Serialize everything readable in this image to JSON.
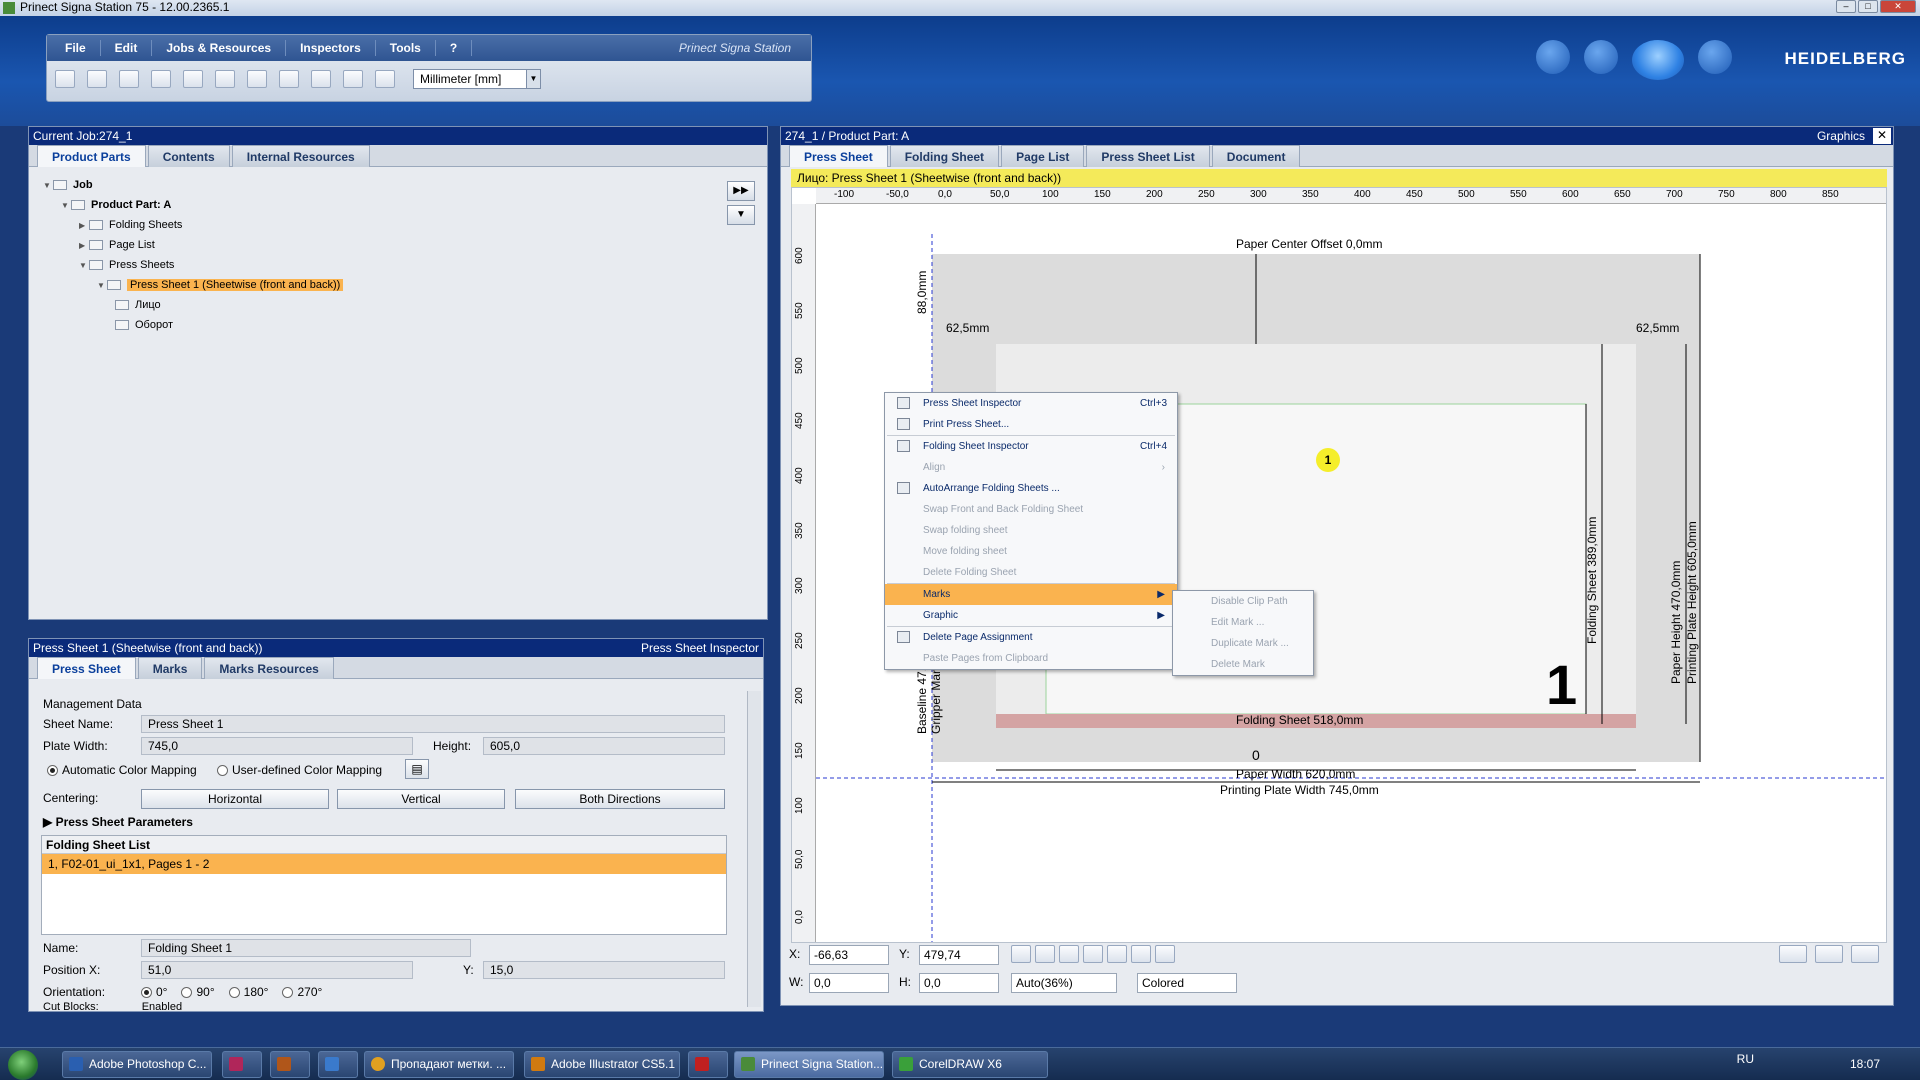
{
  "window": {
    "title": "Prinect Signa Station 75  -  12.00.2365.1"
  },
  "menu": {
    "items": [
      "File",
      "Edit",
      "Jobs & Resources",
      "Inspectors",
      "Tools",
      "?"
    ],
    "brand": "Prinect Signa Station",
    "units": "Millimeter  [mm]"
  },
  "logo": "HEIDELBERG",
  "left_top": {
    "header": "Current Job:274_1",
    "tabs": [
      "Product Parts",
      "Contents",
      "Internal Resources"
    ],
    "tree": [
      {
        "label": "Job",
        "level": 0
      },
      {
        "label": "Product Part: A",
        "level": 1
      },
      {
        "label": "Folding Sheets",
        "level": 2
      },
      {
        "label": "Page List",
        "level": 2
      },
      {
        "label": "Press Sheets",
        "level": 2
      },
      {
        "label": "Press Sheet 1 (Sheetwise (front and back))",
        "level": 3
      },
      {
        "label": "Лицо",
        "level": 4
      },
      {
        "label": "Оборот",
        "level": 4
      }
    ]
  },
  "left_bottom": {
    "header": "Press Sheet 1 (Sheetwise (front and back))",
    "header_right": "Press Sheet Inspector",
    "tabs": [
      "Press Sheet",
      "Marks",
      "Marks Resources"
    ],
    "management": "Management Data",
    "sheet_name_label": "Sheet Name:",
    "sheet_name": "Press Sheet 1",
    "plate_width_label": "Plate Width:",
    "plate_width": "745,0",
    "height_label": "Height:",
    "height": "605,0",
    "auto_color": "Automatic Color Mapping",
    "user_color": "User-defined Color Mapping",
    "centering_label": "Centering:",
    "btn_h": "Horizontal",
    "btn_v": "Vertical",
    "btn_both": "Both Directions",
    "params": "Press Sheet Parameters",
    "fs_list_header": "Folding Sheet List",
    "fs_list_row": "1, F02-01_ui_1x1, Pages 1 - 2",
    "name_label": "Name:",
    "name": "Folding Sheet 1",
    "pos_x_label": "Position X:",
    "pos_x": "51,0",
    "y_label": "Y:",
    "y": "15,0",
    "orientation_label": "Orientation:",
    "orients": [
      "0°",
      "90°",
      "180°",
      "270°"
    ],
    "cut_label": "Cut Blocks:",
    "cut_value": "Enabled"
  },
  "right": {
    "header": "274_1 / Product Part: A",
    "header_right": "Graphics",
    "tabs": [
      "Press Sheet",
      "Folding Sheet",
      "Page List",
      "Press Sheet List",
      "Document"
    ],
    "yellow": "Лицо:  Press Sheet 1 (Sheetwise (front and back))",
    "ruler_h": [
      "-100",
      "-50,0",
      "0,0",
      "50,0",
      "100",
      "150",
      "200",
      "250",
      "300",
      "350",
      "400",
      "450",
      "500",
      "550",
      "600",
      "650",
      "700",
      "750",
      "800",
      "850"
    ],
    "ruler_v": [
      "600",
      "550",
      "500",
      "450",
      "400",
      "350",
      "300",
      "250",
      "200",
      "150",
      "100",
      "50,0",
      "0,0"
    ],
    "dims": {
      "paper_center": "Paper Center Offset 0,0mm",
      "top": "88,0mm",
      "left_m": "62,5mm",
      "right_m": "62,5mm",
      "folding_sheet_w": "Folding Sheet 518,0mm",
      "paper_w": "Paper Width 620,0mm",
      "plate_w": "Printing Plate Width 745,0mm",
      "folding_sheet_h": "Folding Sheet 389,0mm",
      "paper_h": "Paper Height 470,0mm",
      "plate_h": "Printing Plate Height 605,0mm",
      "baseline": "Baseline 47,0mm",
      "gripper": "Gripper Margin 15,0mm",
      "page_num": "1",
      "zero": "0"
    },
    "ctx": [
      {
        "label": "Press Sheet Inspector",
        "sc": "Ctrl+3"
      },
      {
        "label": "Print Press Sheet...",
        "sc": ""
      },
      {
        "label": "Folding Sheet Inspector",
        "sc": "Ctrl+4"
      },
      {
        "label": "Align",
        "sc": "",
        "dis": true,
        "sub": true
      },
      {
        "label": "AutoArrange Folding Sheets ...",
        "sc": ""
      },
      {
        "label": "Swap Front and Back Folding Sheet",
        "dis": true
      },
      {
        "label": "Swap folding sheet",
        "dis": true
      },
      {
        "label": "Move folding sheet",
        "dis": true
      },
      {
        "label": "Delete Folding Sheet",
        "dis": true
      },
      {
        "label": "Marks",
        "hl": true,
        "sub": true
      },
      {
        "label": "Graphic",
        "sub": true
      },
      {
        "label": "Delete Page Assignment"
      },
      {
        "label": "Paste Pages from Clipboard",
        "dis": true
      }
    ],
    "subctx": [
      "Disable Clip Path",
      "Edit Mark ...",
      "Duplicate Mark ...",
      "Delete Mark"
    ],
    "callout": "1",
    "status": {
      "x_label": "X:",
      "x": "-66,63",
      "y_label": "Y:",
      "y": "479,74",
      "w_label": "W:",
      "w": "0,0",
      "h_label": "H:",
      "h": "0,0",
      "zoom": "Auto(36%)",
      "mode": "Colored"
    }
  },
  "taskbar": {
    "items": [
      "Adobe Photoshop C...",
      "",
      "",
      "",
      "Пропадают метки. ...",
      "Adobe Illustrator CS5.1",
      "",
      "Prinect Signa Station...",
      "CorelDRAW X6"
    ],
    "lang": "RU",
    "clock": "18:07"
  }
}
